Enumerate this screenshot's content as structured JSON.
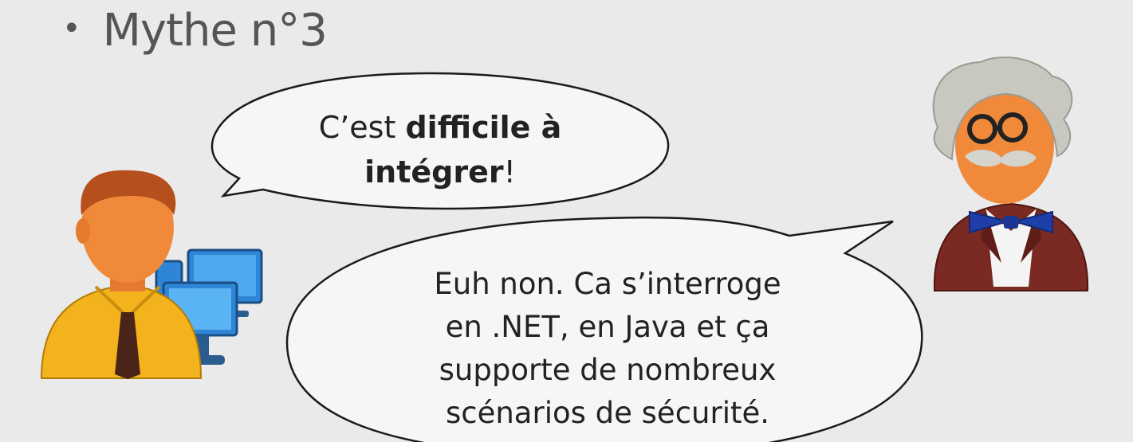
{
  "slide": {
    "title": "Mythe n°3",
    "bullet": "•"
  },
  "speech_bubble_question": {
    "segments": [
      {
        "text": "C’est ",
        "bold": false
      },
      {
        "text": "difficile à",
        "bold": true
      },
      {
        "text": "\n",
        "bold": false
      },
      {
        "text": "intégrer",
        "bold": true
      },
      {
        "text": "!",
        "bold": false
      }
    ]
  },
  "speech_bubble_answer": {
    "lines": [
      "Euh non. Ca s’interroge",
      "en .NET, en Java et ça",
      "supporte de nombreux",
      "scénarios de sécurité."
    ]
  },
  "characters": {
    "left": "developer-with-computers",
    "right": "professor-with-bowtie"
  },
  "colors": {
    "background": "#eaeaea",
    "title": "#555555",
    "developer_shirt": "#f2b31c",
    "developer_skin": "#f08a3a",
    "developer_hair": "#b5501d",
    "monitor": "#2f86d6",
    "professor_jacket": "#7a2a22",
    "professor_bowtie": "#1f3fa8",
    "professor_hair": "#c8c8c0"
  }
}
